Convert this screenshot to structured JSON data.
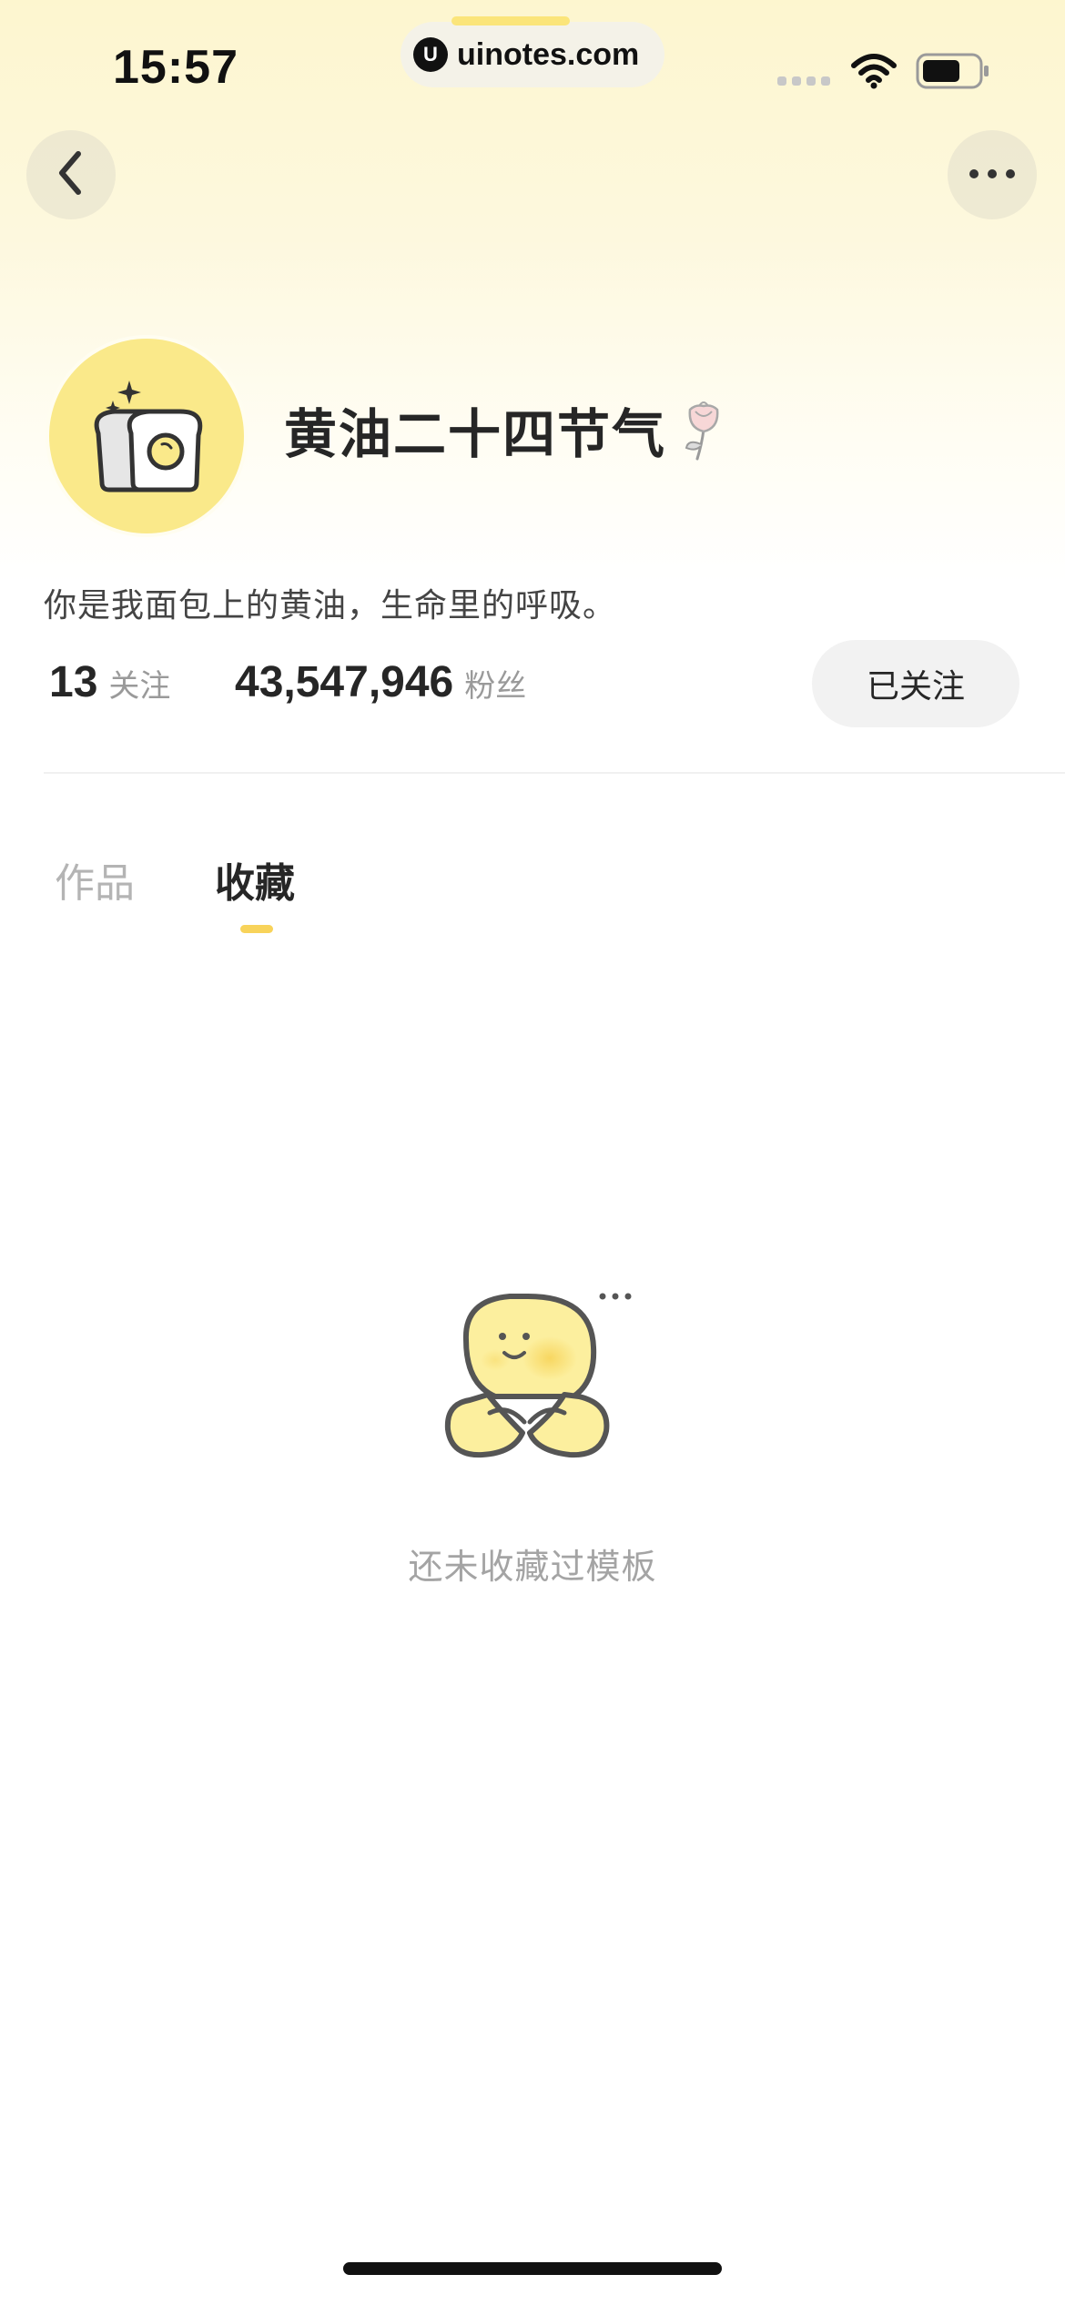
{
  "status_bar": {
    "time": "15:57",
    "url": "uinotes.com",
    "logo_letter": "U",
    "icons": [
      "signal-icon",
      "wifi-icon",
      "battery-icon"
    ]
  },
  "nav": {
    "back_icon": "chevron-left-icon",
    "more_icon": "ellipsis-icon"
  },
  "profile": {
    "avatar_icon": "bread-toast-icon",
    "username": "黄油二十四节气",
    "badge_icon": "rose-icon",
    "bio": "你是我面包上的黄油，生命里的呼吸。",
    "following_count": "13",
    "following_label": "关注",
    "followers_count": "43,547,946",
    "followers_label": "粉丝",
    "follow_button_label": "已关注"
  },
  "tabs": [
    {
      "label": "作品",
      "active": false
    },
    {
      "label": "收藏",
      "active": true
    }
  ],
  "empty_state": {
    "illustration": "butter-mascot-icon",
    "message": "还未收藏过模板"
  },
  "colors": {
    "accent": "#f8d35a",
    "avatar_bg": "#fae98a",
    "header_bg": "#fdf6cf"
  }
}
